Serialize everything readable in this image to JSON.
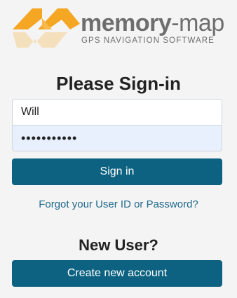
{
  "logo": {
    "word_bold": "memory",
    "word_regular": "-map",
    "tagline": "GPS NAVIGATION SOFTWARE",
    "colors": {
      "orange": "#f5a623",
      "text": "#6e6e6e"
    }
  },
  "signin": {
    "title": "Please Sign-in",
    "username_value": "Will",
    "password_value": "•••••••••••",
    "submit_label": "Sign in",
    "forgot_link": "Forgot your User ID or Password?"
  },
  "newuser": {
    "title": "New User?",
    "create_label": "Create new account"
  },
  "colors": {
    "button": "#0d6281",
    "link": "#1f6a8c",
    "background": "#f4f4f4",
    "autofill": "#e8f0fe"
  }
}
